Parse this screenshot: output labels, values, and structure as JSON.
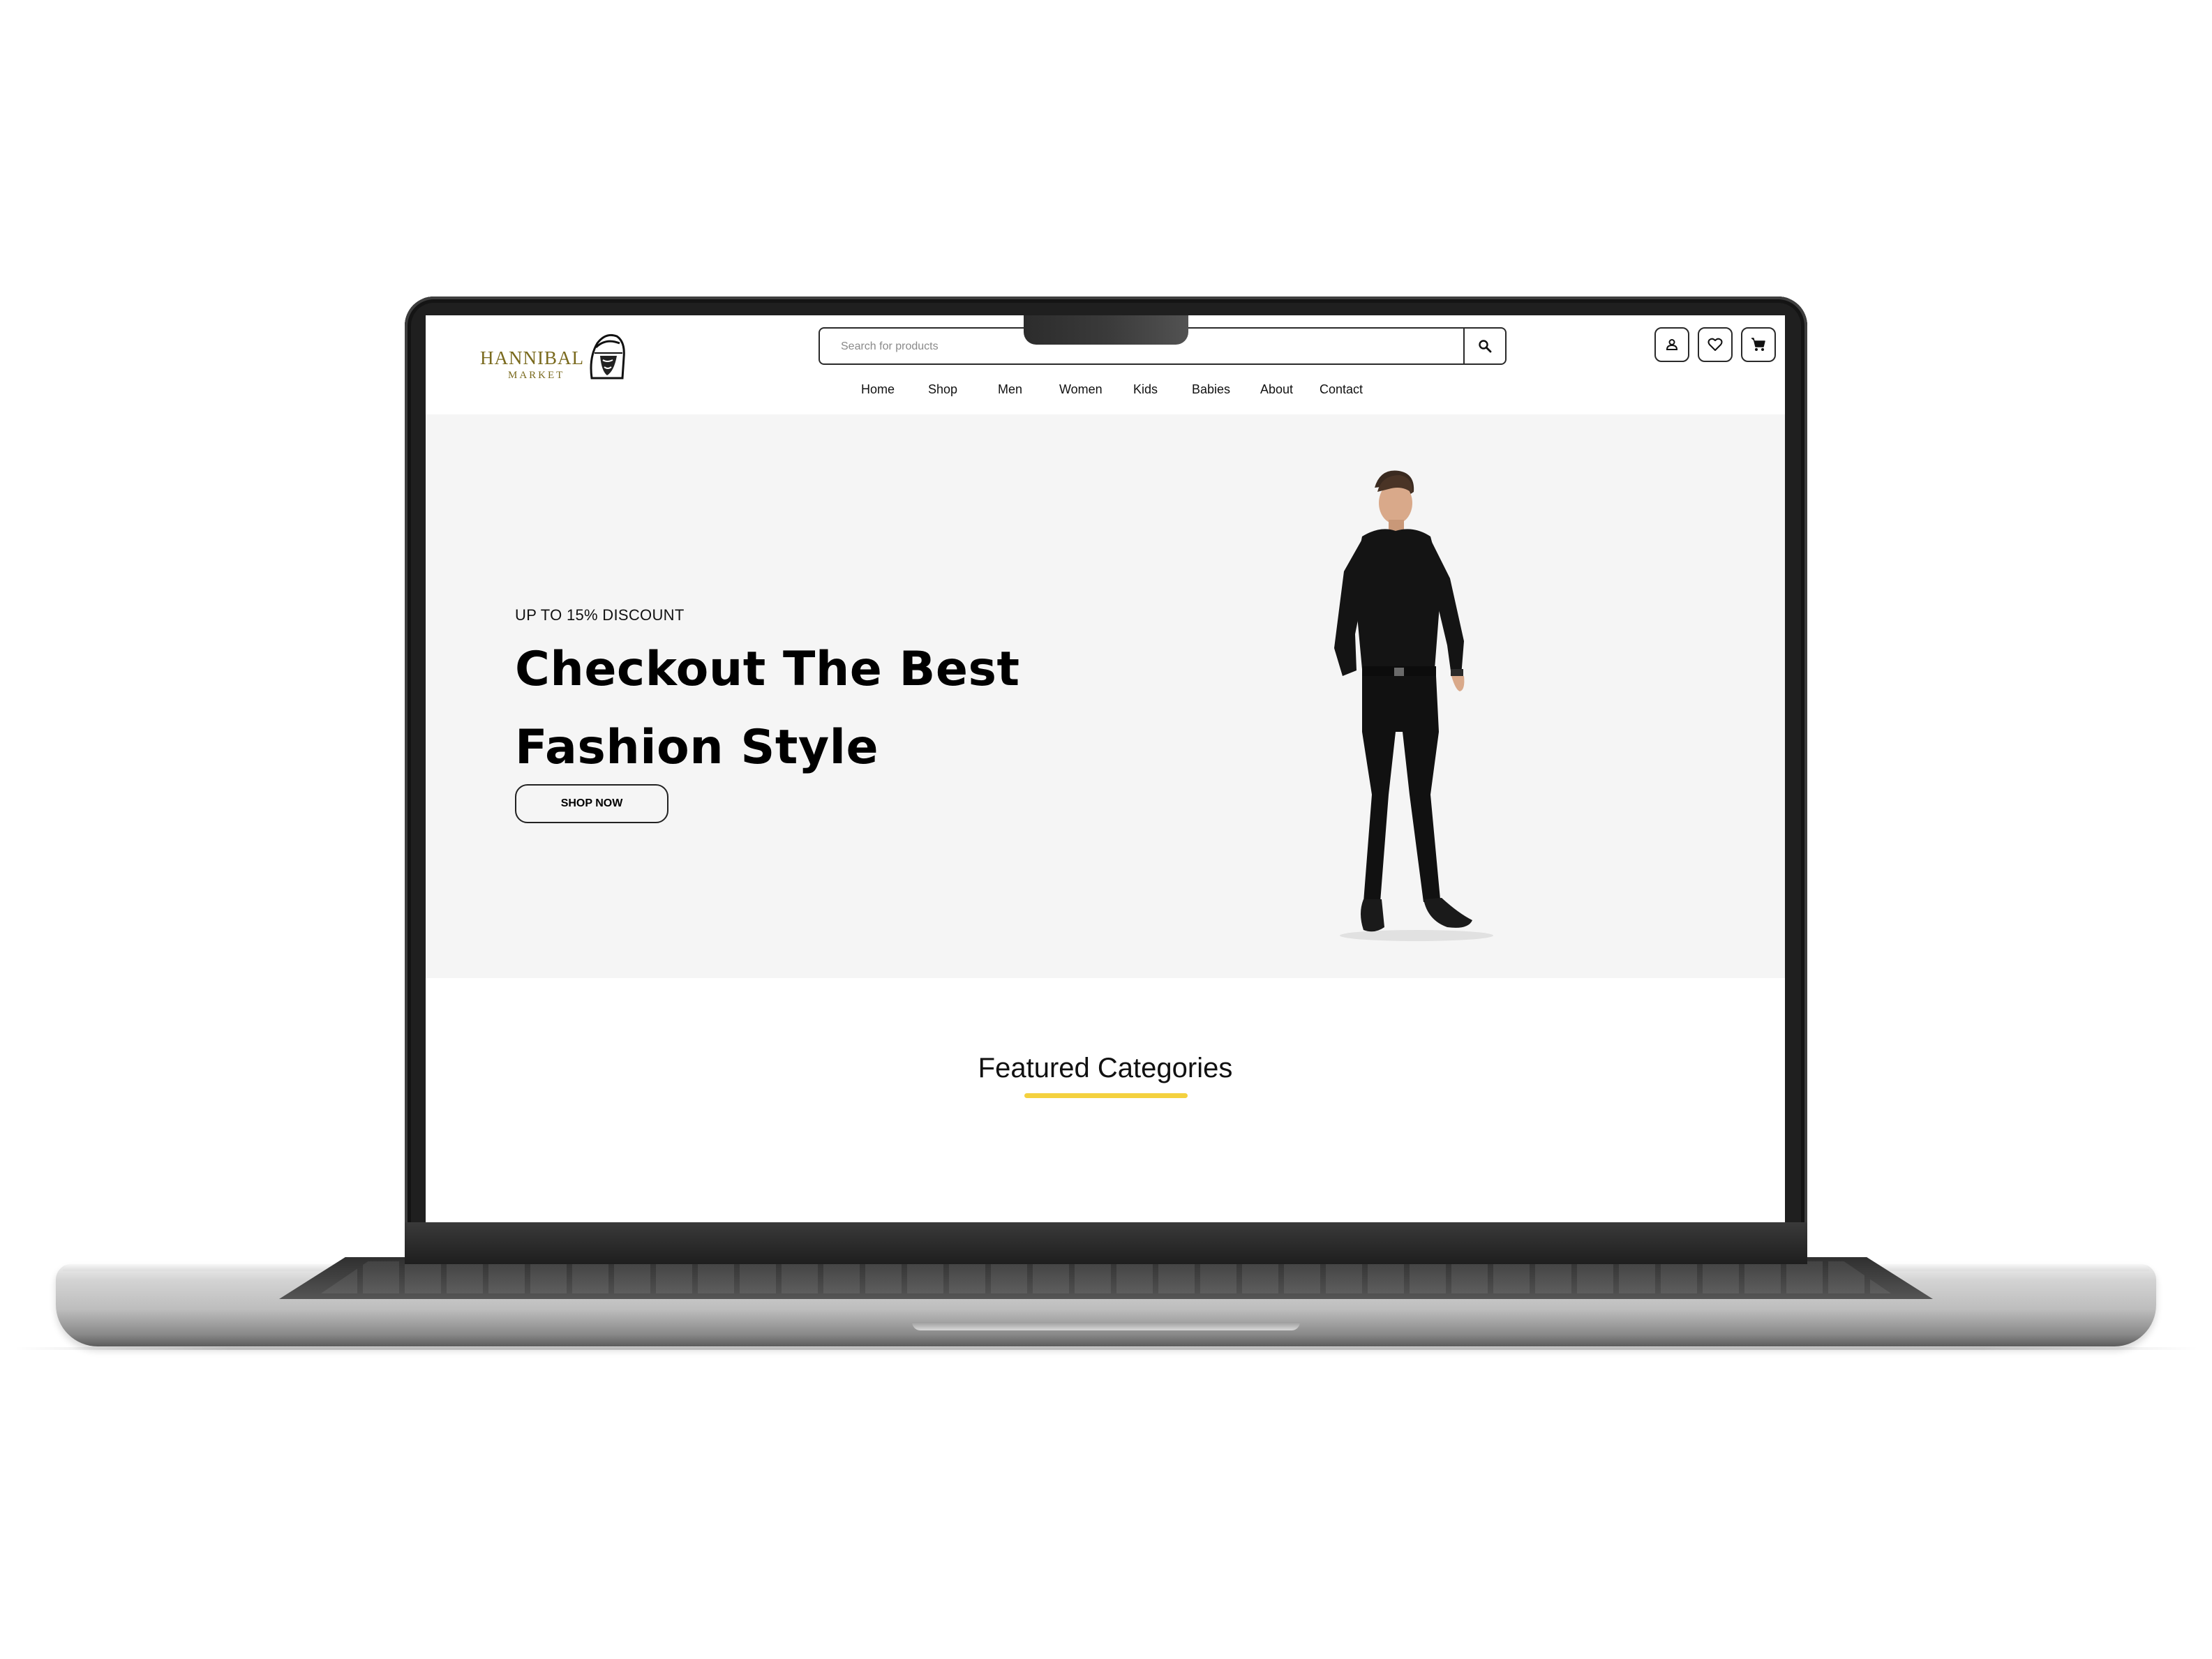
{
  "brand": {
    "name": "HANNIBAL",
    "sub": "MARKET",
    "color": "#7a6a1e"
  },
  "search": {
    "placeholder": "Search for products",
    "value": "",
    "icon": "search-icon"
  },
  "header_icons": [
    {
      "name": "user-icon"
    },
    {
      "name": "heart-icon"
    },
    {
      "name": "cart-icon"
    }
  ],
  "nav": {
    "items": [
      {
        "label": "Home"
      },
      {
        "label": "Shop"
      },
      {
        "label": "Men"
      },
      {
        "label": "Women"
      },
      {
        "label": "Kids"
      },
      {
        "label": "Babies"
      },
      {
        "label": "About"
      },
      {
        "label": "Contact"
      }
    ]
  },
  "hero": {
    "discount": "UP TO 15% DISCOUNT",
    "title_line1": "Checkout The Best",
    "title_line2": "Fashion Style",
    "button_label": "SHOP NOW",
    "background": "#f5f5f5"
  },
  "featured": {
    "title": "Featured Categories",
    "underline_color": "#f4d13f"
  }
}
